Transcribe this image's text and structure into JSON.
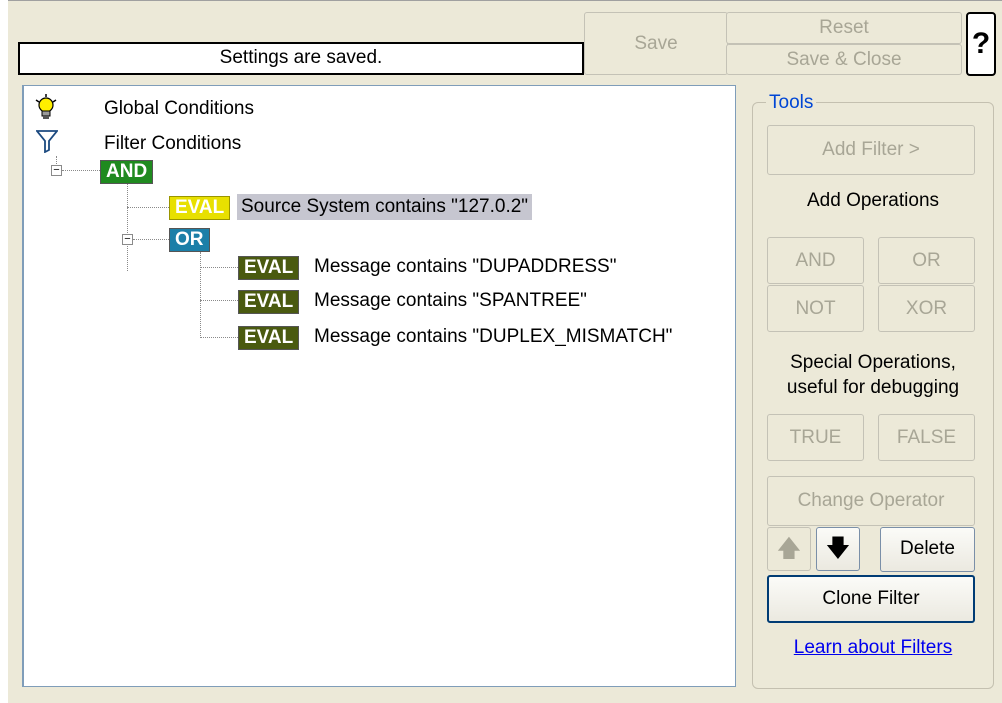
{
  "status": {
    "text": "Settings are saved."
  },
  "toolbar": {
    "save": "Save",
    "reset": "Reset",
    "save_close": "Save & Close",
    "help": "?"
  },
  "tree": {
    "global_conditions": "Global Conditions",
    "filter_conditions": "Filter Conditions",
    "and_tag": "AND",
    "or_tag": "OR",
    "eval_tag": "EVAL",
    "expand_glyph": "−",
    "items": {
      "cond1": "Source System contains \"127.0.2\"",
      "cond2": "Message contains \"DUPADDRESS\"",
      "cond3": "Message contains \"SPANTREE\"",
      "cond4": "Message contains \"DUPLEX_MISMATCH\""
    }
  },
  "tools": {
    "legend": "Tools",
    "add_filter": "Add Filter >",
    "add_operations": "Add Operations",
    "and": "AND",
    "or": "OR",
    "not": "NOT",
    "xor": "XOR",
    "special_line1": "Special Operations,",
    "special_line2": "useful for debugging",
    "true": "TRUE",
    "false": "FALSE",
    "change_operator": "Change Operator",
    "up_arrow": "🡅",
    "down_arrow": "🡇",
    "delete": "Delete",
    "clone_filter": "Clone Filter",
    "learn": "Learn about Filters"
  },
  "colors": {
    "and_tag": "#1f8a1f",
    "or_tag": "#1c7fa8",
    "eval_selected": "#e8e000",
    "eval_normal": "#4a5a10",
    "link": "#0000ee",
    "tools_legend": "#0046d5"
  },
  "icons": {
    "global_conditions": "lightbulb-icon",
    "filter_conditions": "funnel-icon"
  }
}
